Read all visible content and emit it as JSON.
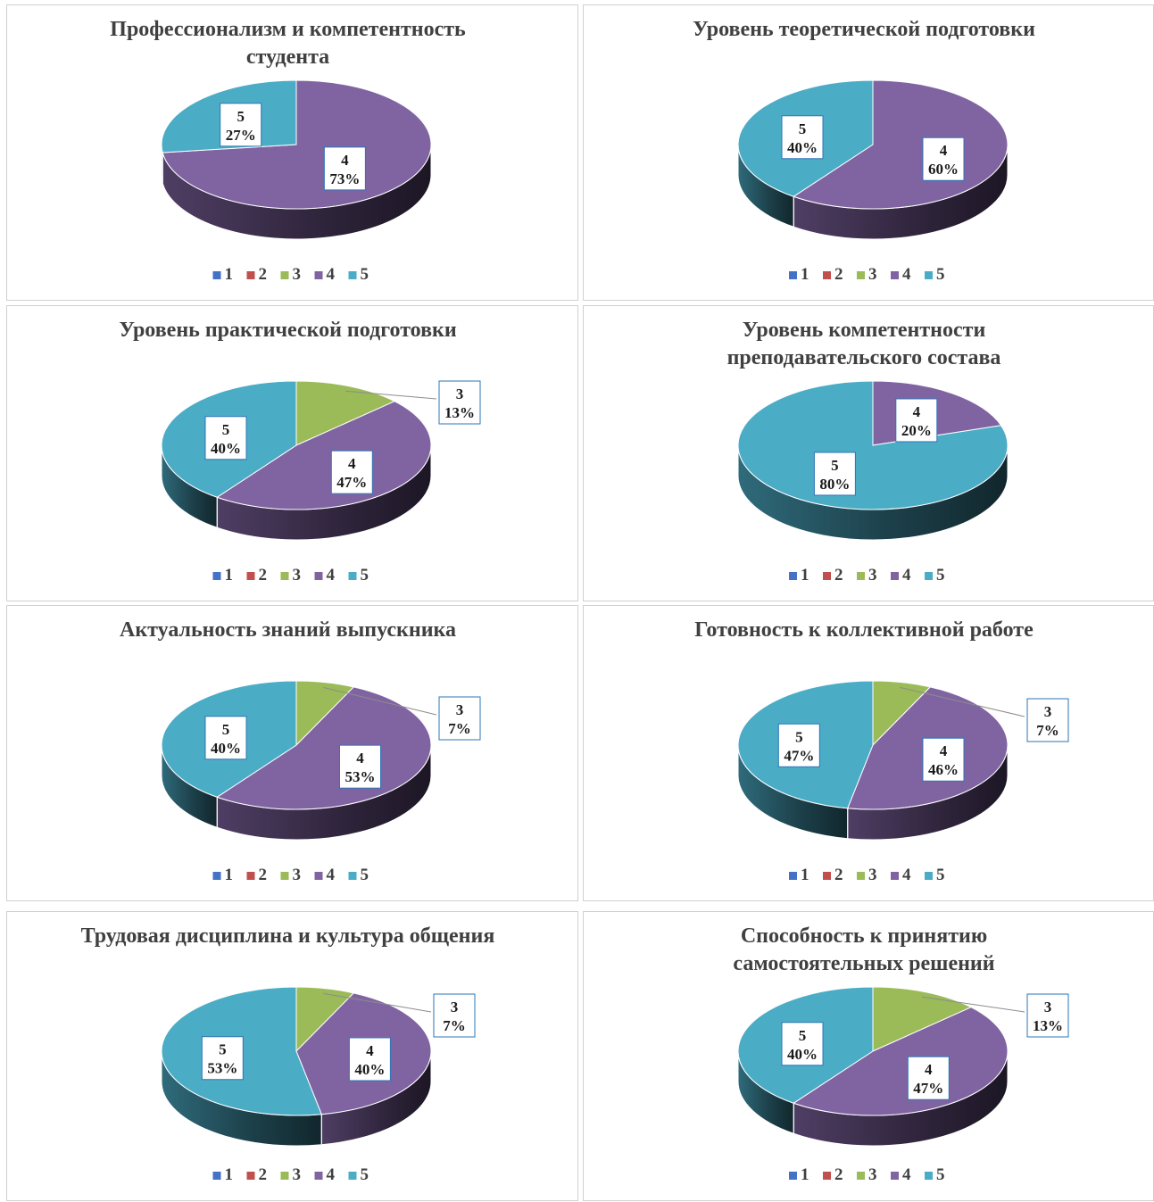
{
  "legend_categories": [
    "1",
    "2",
    "3",
    "4",
    "5"
  ],
  "colors": {
    "1": "#4472c4",
    "2": "#c0504d",
    "3": "#9bbb59",
    "4": "#8064a2",
    "5": "#4bacc6"
  },
  "chart_data": [
    {
      "type": "pie",
      "title": [
        "Профессионализм и компетентность",
        "студента"
      ],
      "categories": [
        "1",
        "2",
        "3",
        "4",
        "5"
      ],
      "values": [
        0,
        0,
        0,
        73,
        27
      ],
      "labels": {
        "4": "73%",
        "5": "27%"
      }
    },
    {
      "type": "pie",
      "title": [
        "Уровень теоретической подготовки"
      ],
      "categories": [
        "1",
        "2",
        "3",
        "4",
        "5"
      ],
      "values": [
        0,
        0,
        0,
        60,
        40
      ],
      "labels": {
        "4": "60%",
        "5": "40%"
      }
    },
    {
      "type": "pie",
      "title": [
        "Уровень практической подготовки"
      ],
      "categories": [
        "1",
        "2",
        "3",
        "4",
        "5"
      ],
      "values": [
        0,
        0,
        13,
        47,
        40
      ],
      "labels": {
        "3": "13%",
        "4": "47%",
        "5": "40%"
      }
    },
    {
      "type": "pie",
      "title": [
        "Уровень компетентности",
        "преподавательского состава"
      ],
      "categories": [
        "1",
        "2",
        "3",
        "4",
        "5"
      ],
      "values": [
        0,
        0,
        0,
        20,
        80
      ],
      "labels": {
        "4": "20%",
        "5": "80%"
      }
    },
    {
      "type": "pie",
      "title": [
        "Актуальность знаний выпускника"
      ],
      "categories": [
        "1",
        "2",
        "3",
        "4",
        "5"
      ],
      "values": [
        0,
        0,
        7,
        53,
        40
      ],
      "labels": {
        "3": "7%",
        "4": "53%",
        "5": "40%"
      }
    },
    {
      "type": "pie",
      "title": [
        "Готовность к коллективной работе"
      ],
      "categories": [
        "1",
        "2",
        "3",
        "4",
        "5"
      ],
      "values": [
        0,
        0,
        7,
        46,
        47
      ],
      "labels": {
        "3": "7%",
        "4": "46%",
        "5": "47%"
      }
    },
    {
      "type": "pie",
      "title": [
        "Трудовая дисциплина и культура общения"
      ],
      "categories": [
        "1",
        "2",
        "3",
        "4",
        "5"
      ],
      "values": [
        0,
        0,
        7,
        40,
        53
      ],
      "labels": {
        "3": "7%",
        "4": "40%",
        "5": "53%"
      }
    },
    {
      "type": "pie",
      "title": [
        "Способность к принятию",
        "самостоятельных решений"
      ],
      "categories": [
        "1",
        "2",
        "3",
        "4",
        "5"
      ],
      "values": [
        0,
        0,
        13,
        47,
        40
      ],
      "labels": {
        "3": "13%",
        "4": "47%",
        "5": "40%"
      }
    }
  ]
}
